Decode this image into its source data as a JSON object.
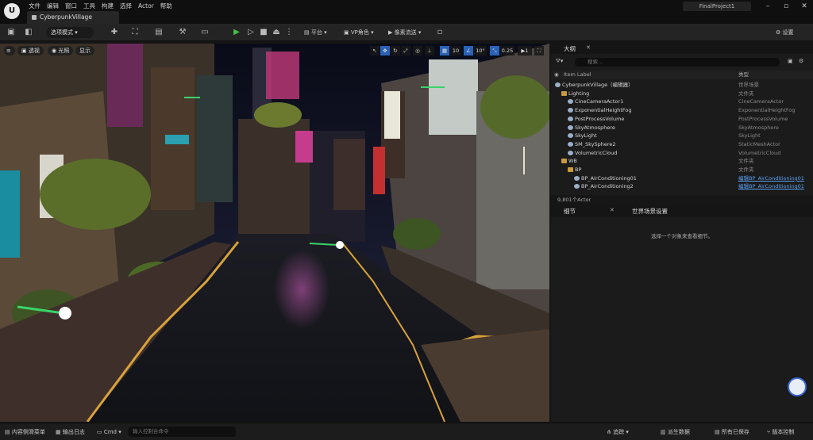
{
  "menu": [
    "文件",
    "编辑",
    "窗口",
    "工具",
    "构建",
    "选择",
    "Actor",
    "帮助"
  ],
  "level_tab": "CyberpunkVillage",
  "project_name": "FinalProject1",
  "toolbar": {
    "select_mode": "选项模式",
    "platform": "平台",
    "vp_role": "VP角色",
    "pixel_streaming": "像素流送",
    "settings": "设置"
  },
  "viewport": {
    "perspective": "透视",
    "lit": "光照",
    "show": "显示",
    "grid_snap": "10",
    "rot_snap": "10°",
    "scale_snap": "0.25",
    "camera_speed": "1"
  },
  "outliner": {
    "tab_label": "大纲",
    "search_placeholder": "搜索...",
    "col_label": "Item Label",
    "col_type": "类型",
    "rows": [
      {
        "label": "CyberpunkVillage（编辑器）",
        "type": "世界场景",
        "kind": "actor"
      },
      {
        "label": "Lighting",
        "type": "文件夹",
        "kind": "folder"
      },
      {
        "label": "CineCameraActor1",
        "type": "CineCameraActor",
        "kind": "actor"
      },
      {
        "label": "ExponentialHeightFog",
        "type": "ExponentialHeightFog",
        "kind": "actor"
      },
      {
        "label": "PostProcessVolume",
        "type": "PostProcessVolume",
        "kind": "actor"
      },
      {
        "label": "SkyAtmosphere",
        "type": "SkyAtmosphere",
        "kind": "actor"
      },
      {
        "label": "SkyLight",
        "type": "SkyLight",
        "kind": "actor"
      },
      {
        "label": "SM_SkySphere2",
        "type": "StaticMeshActor",
        "kind": "actor"
      },
      {
        "label": "VolumetricCloud",
        "type": "VolumetricCloud",
        "kind": "actor"
      },
      {
        "label": "WB",
        "type": "文件夹",
        "kind": "folder"
      },
      {
        "label": "BP",
        "type": "文件夹",
        "kind": "folder"
      },
      {
        "label": "BP_AirConditioning01",
        "type": "编辑BP_AirConditioning01",
        "kind": "actor"
      },
      {
        "label": "BP_AirConditioning2",
        "type": "编辑BP_AirConditioning01",
        "kind": "actor"
      }
    ],
    "actor_count": "9,801个Actor"
  },
  "details": {
    "tab_details": "细节",
    "tab_world": "世界场景设置",
    "empty_message": "选择一个对象来查看细节。"
  },
  "statusbar": {
    "content_drawer": "内容侧滑菜单",
    "output_log": "输出日志",
    "cmd": "Cmd",
    "cmd_placeholder": "输入控制台命令",
    "trace": "追踪",
    "derived_data": "派生数据",
    "all_saved": "所有已保存",
    "source_control": "版本控制"
  },
  "colors": {
    "accent_blue": "#2a62b8",
    "play_green": "#46c046",
    "folder": "#c89a3c"
  }
}
